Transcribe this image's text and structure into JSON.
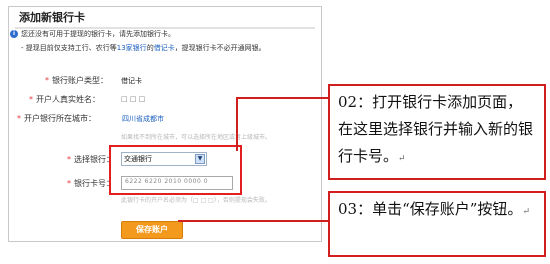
{
  "dialog": {
    "title": "添加新银行卡",
    "notice_line1": "您还没有可用于提现的银行卡，请先添加银行卡。",
    "notice_line2_pre": "- 提现目前仅支持工行、农行等",
    "notice_line2_link": "13家银行",
    "notice_line2_mid": "的",
    "notice_line2_link2": "借记卡",
    "notice_line2_post": "，提现银行卡不必开通网银。"
  },
  "form": {
    "account_type_label": "银行账户类型：",
    "account_type_value": "借记卡",
    "holder_label": "开户人真实姓名：",
    "holder_value": "□ □ □",
    "city_label": "开户银行所在城市：",
    "city_value": "四川省成都市",
    "city_hint": "如果找不到所在城市，可以选择所在地区或者上级城市。",
    "bank_label": "选择银行：",
    "bank_value": "交通银行",
    "card_label": "银行卡号：",
    "card_value": "6222 6220 2010 0000 0",
    "card_hint": "此银行卡的开户名必须为（□ □ □），否则提现会失败。",
    "save_button": "保存账户"
  },
  "callouts": {
    "step2": "02：打开银行卡添加页面，在这里选择银行并输入新的银行卡号。",
    "step3": "03：单击“保存账户”按钮。",
    "return_mark": "↵"
  },
  "colors": {
    "required": "#e03a3a",
    "link": "#1a5fbf",
    "save_button": "#f39a1e",
    "highlight": "#e21f1f"
  }
}
